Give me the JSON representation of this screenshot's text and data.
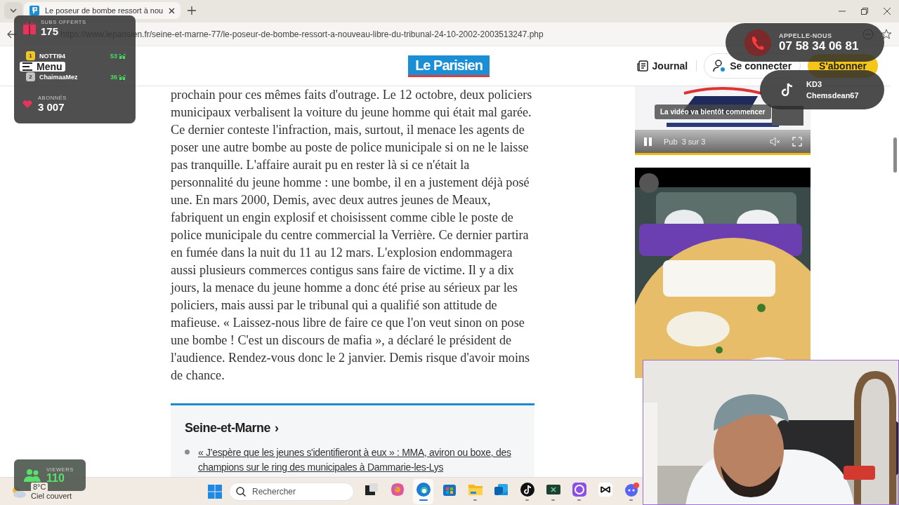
{
  "browser": {
    "tab": {
      "title": "Le poseur de bombe ressort à nou",
      "selected": true
    },
    "url": "https://www.leparisien.fr/seine-et-marne-77/le-poseur-de-bombe-ressort-a-nouveau-libre-du-tribunal-24-10-2002-2003513247.php"
  },
  "site_header": {
    "menu_label": "Menu",
    "logo": "Le Parisien",
    "journal": "Journal",
    "login": "Se connecter",
    "subscribe": "S'abonner"
  },
  "article": {
    "paragraph": "prochain pour ces mêmes faits d'outrage. Le 12 octobre, deux policiers municipaux verbalisent la voiture du jeune homme qui était mal garée. Ce dernier conteste l'infraction, mais, surtout, il menace les agents de poser une autre bombe au poste de police municipale si on ne le laisse pas tranquille. L'affaire aurait pu en rester là si ce n'était la personnalité du jeune homme : une bombe, il en a justement déjà posé une. En mars 2000, Demis, avec deux autres jeunes de Meaux, fabriquent un engin explosif et choisissent comme cible le poste de police municipale du centre commercial la Verrière. Ce dernier partira en fumée dans la nuit du 11 au 12 mars. L'explosion endommagera aussi plusieurs commerces contigus sans faire de victime. Il y a dix jours, la menace du jeune homme a donc été prise au sérieux par les policiers, mais aussi par le tribunal qui a qualifié son attitude de mafieuse. « Laissez-nous libre de faire ce que l'on veut sinon on pose une bombe ! C'est un discours de mafia », a déclaré le président de l'audience. Rendez-vous donc le 2 janvier. Demis risque d'avoir moins de chance."
  },
  "related": {
    "heading": "Seine-et-Marne",
    "arrow": "›",
    "items": [
      {
        "text": "« J'espère que les jeunes s'identifieront à eux » : MMA, aviron ou boxe, des champions sur le ring des municipales à Dammarie-les-Lys"
      }
    ]
  },
  "ads": {
    "video": {
      "status": "La vidéo va bientôt commencer",
      "counter": "Pub  3 sur 3",
      "paused": false
    }
  },
  "taskbar": {
    "weather": {
      "temperature": "8°C",
      "condition": "Ciel couvert"
    },
    "search_placeholder": "Rechercher",
    "apps": [
      {
        "kind": "taskview",
        "open": false,
        "selected": false
      },
      {
        "kind": "copilot",
        "open": false,
        "selected": false
      },
      {
        "kind": "edge",
        "open": true,
        "selected": true
      },
      {
        "kind": "store",
        "open": false,
        "selected": false
      },
      {
        "kind": "folder",
        "open": true,
        "selected": false
      },
      {
        "kind": "mail",
        "open": false,
        "selected": false
      },
      {
        "kind": "tiktok",
        "open": true,
        "selected": false
      },
      {
        "kind": "terminal",
        "open": true,
        "selected": false
      },
      {
        "kind": "circle",
        "open": true,
        "selected": false
      },
      {
        "kind": "capcut",
        "open": false,
        "selected": false
      },
      {
        "kind": "chat",
        "open": true,
        "selected": false
      }
    ]
  },
  "overlays": {
    "subs": {
      "label": "SUBS OFFERTS",
      "count": "175",
      "top": [
        {
          "rank": "1",
          "name": "NOTTI94",
          "gifts": "53",
          "color": "#f2c526"
        },
        {
          "rank": "2",
          "name": "ChaimaaMez",
          "gifts": "36",
          "color": "#c4c4c4"
        }
      ],
      "followers_label": "ABONNÉS",
      "followers": "3 007"
    },
    "viewers": {
      "label": "VIEWERS",
      "count": "110"
    },
    "call": {
      "label": "APPELLE-NOUS",
      "phone": "07 58 34 06 81"
    },
    "tiktok": {
      "line1": "KD3",
      "line2": "Chemsdean67"
    }
  }
}
